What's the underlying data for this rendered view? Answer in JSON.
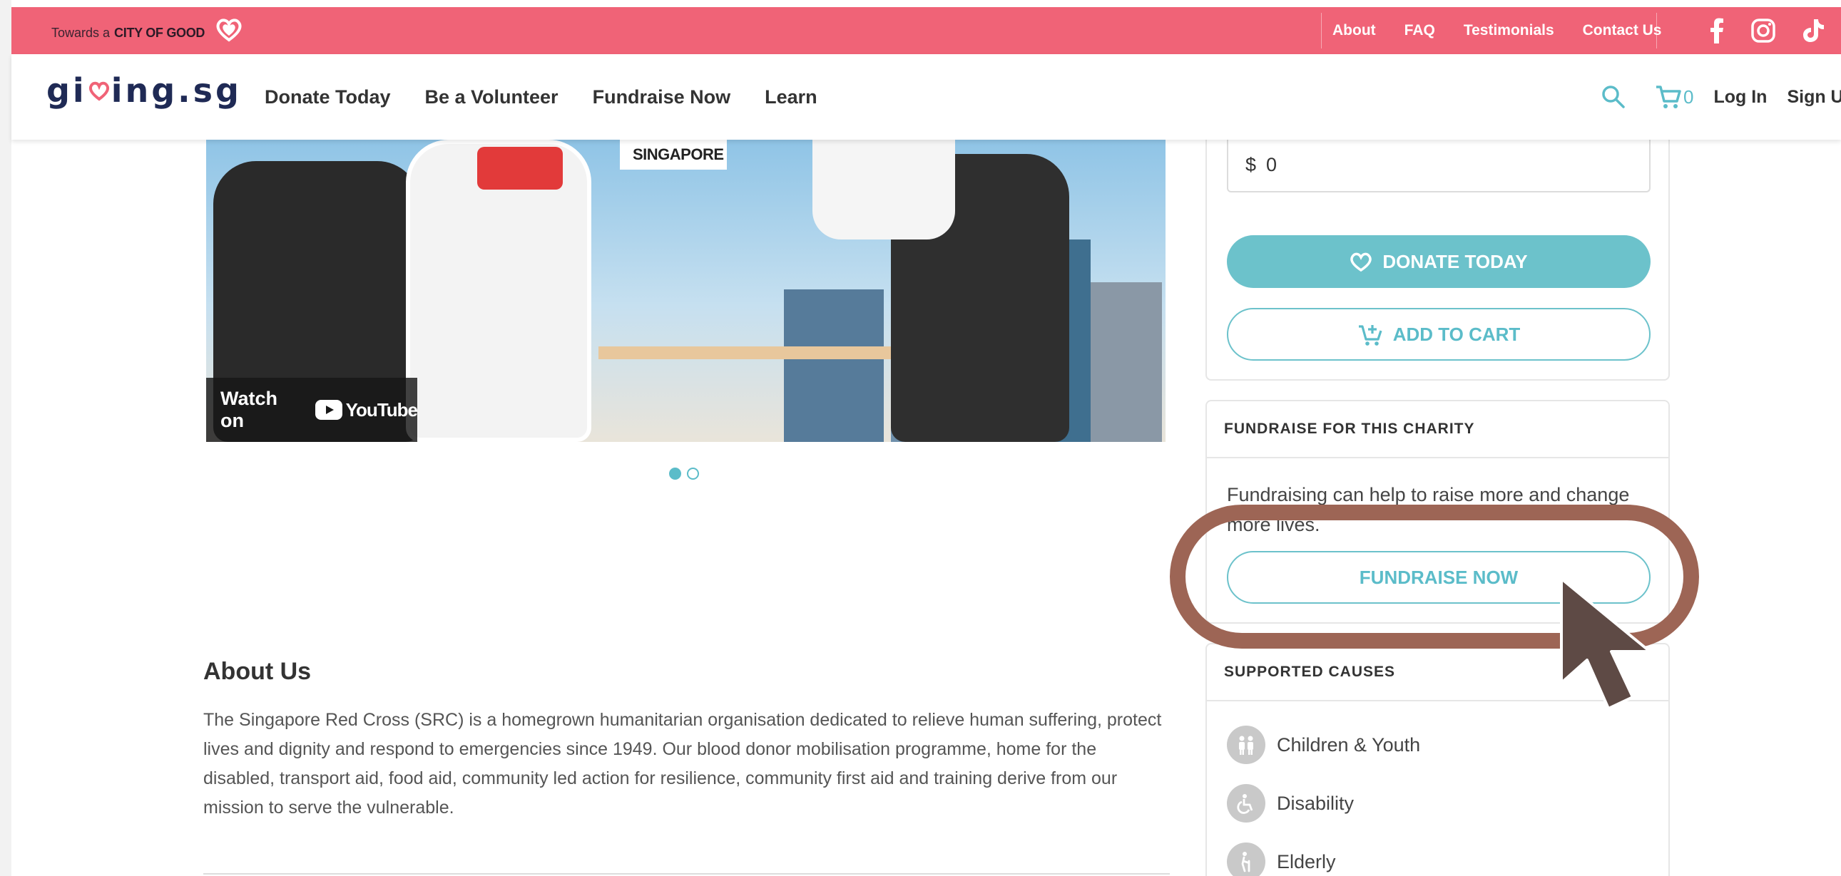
{
  "topbar": {
    "tagline_prefix": "Towards a",
    "tagline_emphasis": "CITY OF GOOD",
    "links": [
      "About",
      "FAQ",
      "Testimonials",
      "Contact Us"
    ],
    "social_icons": [
      "facebook-icon",
      "instagram-icon",
      "tiktok-icon"
    ]
  },
  "nav": {
    "brand_start": "gi",
    "brand_end": "ing.sg",
    "links": [
      "Donate Today",
      "Be a Volunteer",
      "Fundraise Now",
      "Learn"
    ],
    "cart_count": "0",
    "login": "Log In",
    "signup": "Sign Up"
  },
  "hero": {
    "logo_text": "SINGAPORE",
    "watch_label": "Watch on",
    "youtube_label": "YouTube",
    "slides": 2,
    "active_slide": 1
  },
  "about": {
    "title": "About Us",
    "text": "The Singapore Red Cross (SRC) is a homegrown humanitarian organisation dedicated to relieve human suffering, protect lives and dignity and respond to emergencies since 1949. Our blood donor mobilisation programme, home for the disabled, transport aid, food aid, community led action for resilience, community first aid and training derive from our mission to serve the vulnerable."
  },
  "donate_card": {
    "currency": "$",
    "amount": "0",
    "donate_label": "DONATE TODAY",
    "cart_label": "ADD TO CART"
  },
  "fundraise_card": {
    "heading": "FUNDRAISE FOR THIS CHARITY",
    "description": "Fundraising can help to raise more and change more lives.",
    "button_label": "FUNDRAISE NOW"
  },
  "causes_card": {
    "heading": "SUPPORTED CAUSES",
    "items": [
      "Children & Youth",
      "Disability",
      "Elderly"
    ]
  },
  "colors": {
    "topbar_pink": "#f06377",
    "accent_teal": "#6cc2cb",
    "brand_navy": "#1f2a55",
    "annotation_brown": "#9d6555"
  }
}
